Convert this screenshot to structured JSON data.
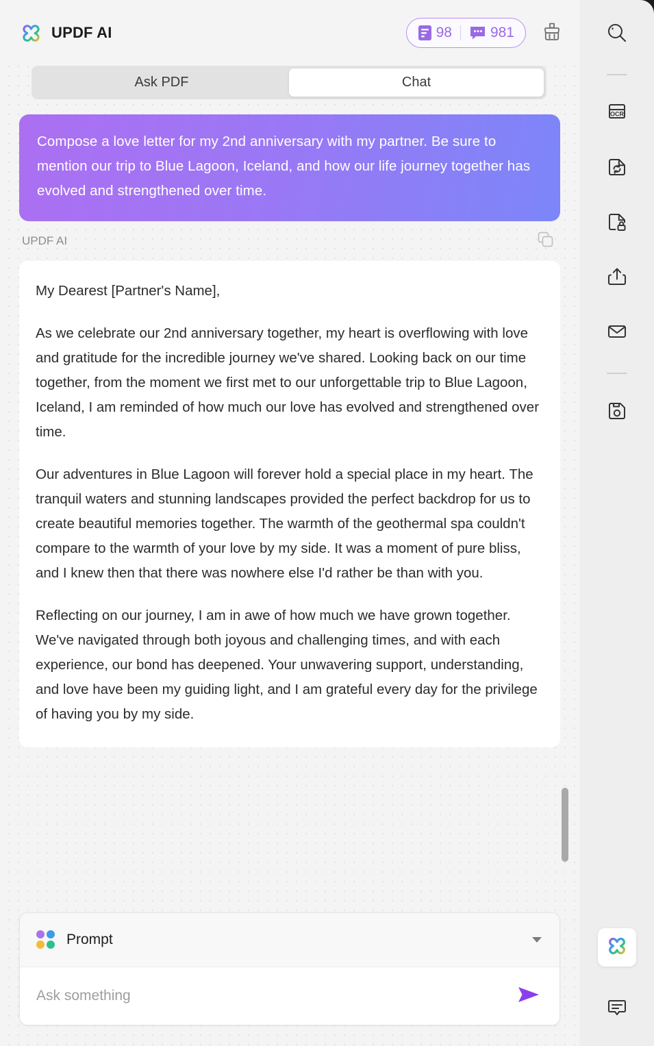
{
  "app": {
    "brand_name": "UPDF AI",
    "logo_icon": "updf-clover-logo"
  },
  "header": {
    "page_count": "98",
    "page_count_icon": "document-lines-icon",
    "chat_count": "981",
    "chat_count_icon": "chat-bubble-icon",
    "clear_icon": "brush-icon",
    "accent_color": "#9a6ae4",
    "pill_border_color": "#b98cf5"
  },
  "tabs": [
    {
      "label": "Ask PDF",
      "active": false
    },
    {
      "label": "Chat",
      "active": true
    }
  ],
  "conversation": {
    "user_message": "Compose a love letter for my 2nd anniversary with my partner. Be sure to mention our trip to Blue Lagoon, Iceland, and how our life journey together has evolved and strengthened over time.",
    "user_bubble_gradient_from": "#ac6ff2",
    "user_bubble_gradient_to": "#7c86f8",
    "assistant_name": "UPDF AI",
    "copy_icon": "copy-icon",
    "assistant_paragraphs": [
      "My Dearest [Partner's Name],",
      "As we celebrate our 2nd anniversary together, my heart is overflowing with love and gratitude for the incredible journey we've shared. Looking back on our time together, from the moment we first met to our unforgettable trip to Blue Lagoon, Iceland, I am reminded of how much our love has evolved and strengthened over time.",
      "Our adventures in Blue Lagoon will forever hold a special place in my heart. The tranquil waters and stunning landscapes provided the perfect backdrop for us to create beautiful memories together. The warmth of the geothermal spa couldn't compare to the warmth of your love by my side. It was a moment of pure bliss, and I knew then that there was nowhere else I'd rather be than with you.",
      "Reflecting on our journey, I am in awe of how much we have grown together. We've navigated through both joyous and challenging times, and with each experience, our bond has deepened. Your unwavering support, understanding, and love have been my guiding light, and I am grateful every day for the privilege of having you by my side."
    ]
  },
  "composer": {
    "prompt_label": "Prompt",
    "prompt_icon": "four-dots-icon",
    "prompt_dot_colors": [
      "#a974e8",
      "#3d9be9",
      "#f5bb33",
      "#2ec08b"
    ],
    "caret_icon": "chevron-down-icon",
    "input_value": "",
    "input_placeholder": "Ask something",
    "send_icon": "send-arrow-icon",
    "send_color": "#8b3dee"
  },
  "toolbar": {
    "items": [
      {
        "name": "search",
        "icon": "search-icon",
        "active": false
      },
      {
        "name": "separator-1",
        "icon": "separator",
        "active": false
      },
      {
        "name": "ocr",
        "icon": "ocr-icon",
        "active": false
      },
      {
        "name": "convert",
        "icon": "convert-document-icon",
        "active": false
      },
      {
        "name": "protect",
        "icon": "lock-document-icon",
        "active": false
      },
      {
        "name": "share",
        "icon": "share-upload-icon",
        "active": false
      },
      {
        "name": "email",
        "icon": "envelope-icon",
        "active": false
      },
      {
        "name": "separator-2",
        "icon": "separator",
        "active": false
      },
      {
        "name": "save",
        "icon": "save-disk-icon",
        "active": false
      }
    ],
    "bottom_items": [
      {
        "name": "updf-ai",
        "icon": "updf-clover-logo",
        "active": true
      },
      {
        "name": "comment",
        "icon": "comment-bubble-icon",
        "active": false
      }
    ]
  }
}
